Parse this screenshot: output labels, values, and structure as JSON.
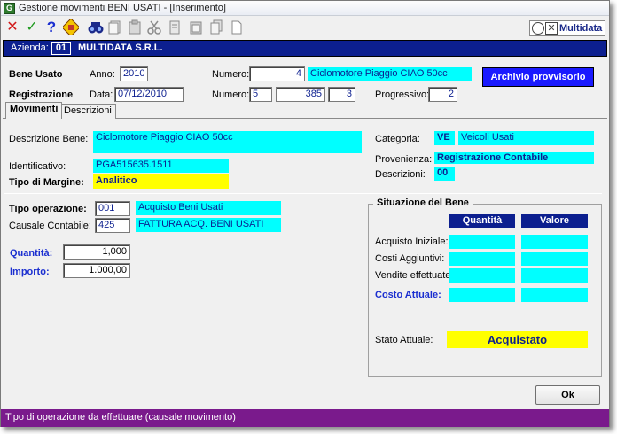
{
  "window": {
    "title": "Gestione movimenti BENI USATI - [Inserimento]"
  },
  "toolbar": {
    "icons": [
      "close-icon",
      "confirm-icon",
      "help-icon",
      "edit-icon",
      "search-icon",
      "copy-icon",
      "paste-icon",
      "cut-icon",
      "document-icon",
      "blank-page-icon"
    ],
    "logo_text": "Multidata"
  },
  "company": {
    "label": "Azienda:",
    "code": "01",
    "name": "MULTIDATA S.R.L."
  },
  "bene_usato": {
    "label": "Bene Usato",
    "anno_label": "Anno:",
    "anno": "2010",
    "numero_label": "Numero:",
    "numero": "4",
    "descrizione": "Ciclomotore Piaggio CIAO 50cc"
  },
  "registrazione": {
    "label": "Registrazione",
    "data_label": "Data:",
    "data": "07/12/2010",
    "numero_label": "Numero:",
    "numero_1": "5",
    "numero_2": "385",
    "numero_3": "3",
    "progressivo_label": "Progressivo:",
    "progressivo": "2"
  },
  "archivio_button": "Archivio provvisorio",
  "tabs": [
    {
      "label": "Movimenti",
      "active": true
    },
    {
      "label": "Descrizioni",
      "active": false
    }
  ],
  "dettaglio": {
    "descrizione_label": "Descrizione Bene:",
    "descrizione": "Ciclomotore Piaggio CIAO 50cc",
    "identificativo_label": "Identificativo:",
    "identificativo": "PGA515635.1511",
    "margine_label": "Tipo di Margine:",
    "margine": "Analitico",
    "categoria_label": "Categoria:",
    "categoria_code": "VE",
    "categoria_desc": "Veicoli Usati",
    "provenienza_label": "Provenienza:",
    "provenienza": "Registrazione Contabile",
    "descrizioni_label": "Descrizioni:",
    "descrizioni": "00"
  },
  "operazione": {
    "tipo_label": "Tipo operazione:",
    "tipo_code": "001",
    "tipo_desc": "Acquisto Beni Usati",
    "causale_label": "Causale Contabile:",
    "causale_code": "425",
    "causale_desc": "FATTURA ACQ. BENI USATI",
    "quantita_label": "Quantità:",
    "quantita": "1,000",
    "importo_label": "Importo:",
    "importo": "1.000,00"
  },
  "situazione": {
    "title": "Situazione del Bene",
    "col_quantita": "Quantità",
    "col_valore": "Valore",
    "rows": [
      "Acquisto Iniziale:",
      "Costi Aggiuntivi:",
      "Vendite effettuate:",
      "Costo Attuale:"
    ],
    "stato_label": "Stato Attuale:",
    "stato": "Acquistato"
  },
  "ok_button": "Ok",
  "status_bar": "Tipo di operazione da effettuare (causale movimento)",
  "colors": {
    "field_cyan": "#00ffff",
    "field_yellow": "#ffff00",
    "header_blue": "#0c1f8f",
    "status_purple": "#7a1a8c"
  }
}
